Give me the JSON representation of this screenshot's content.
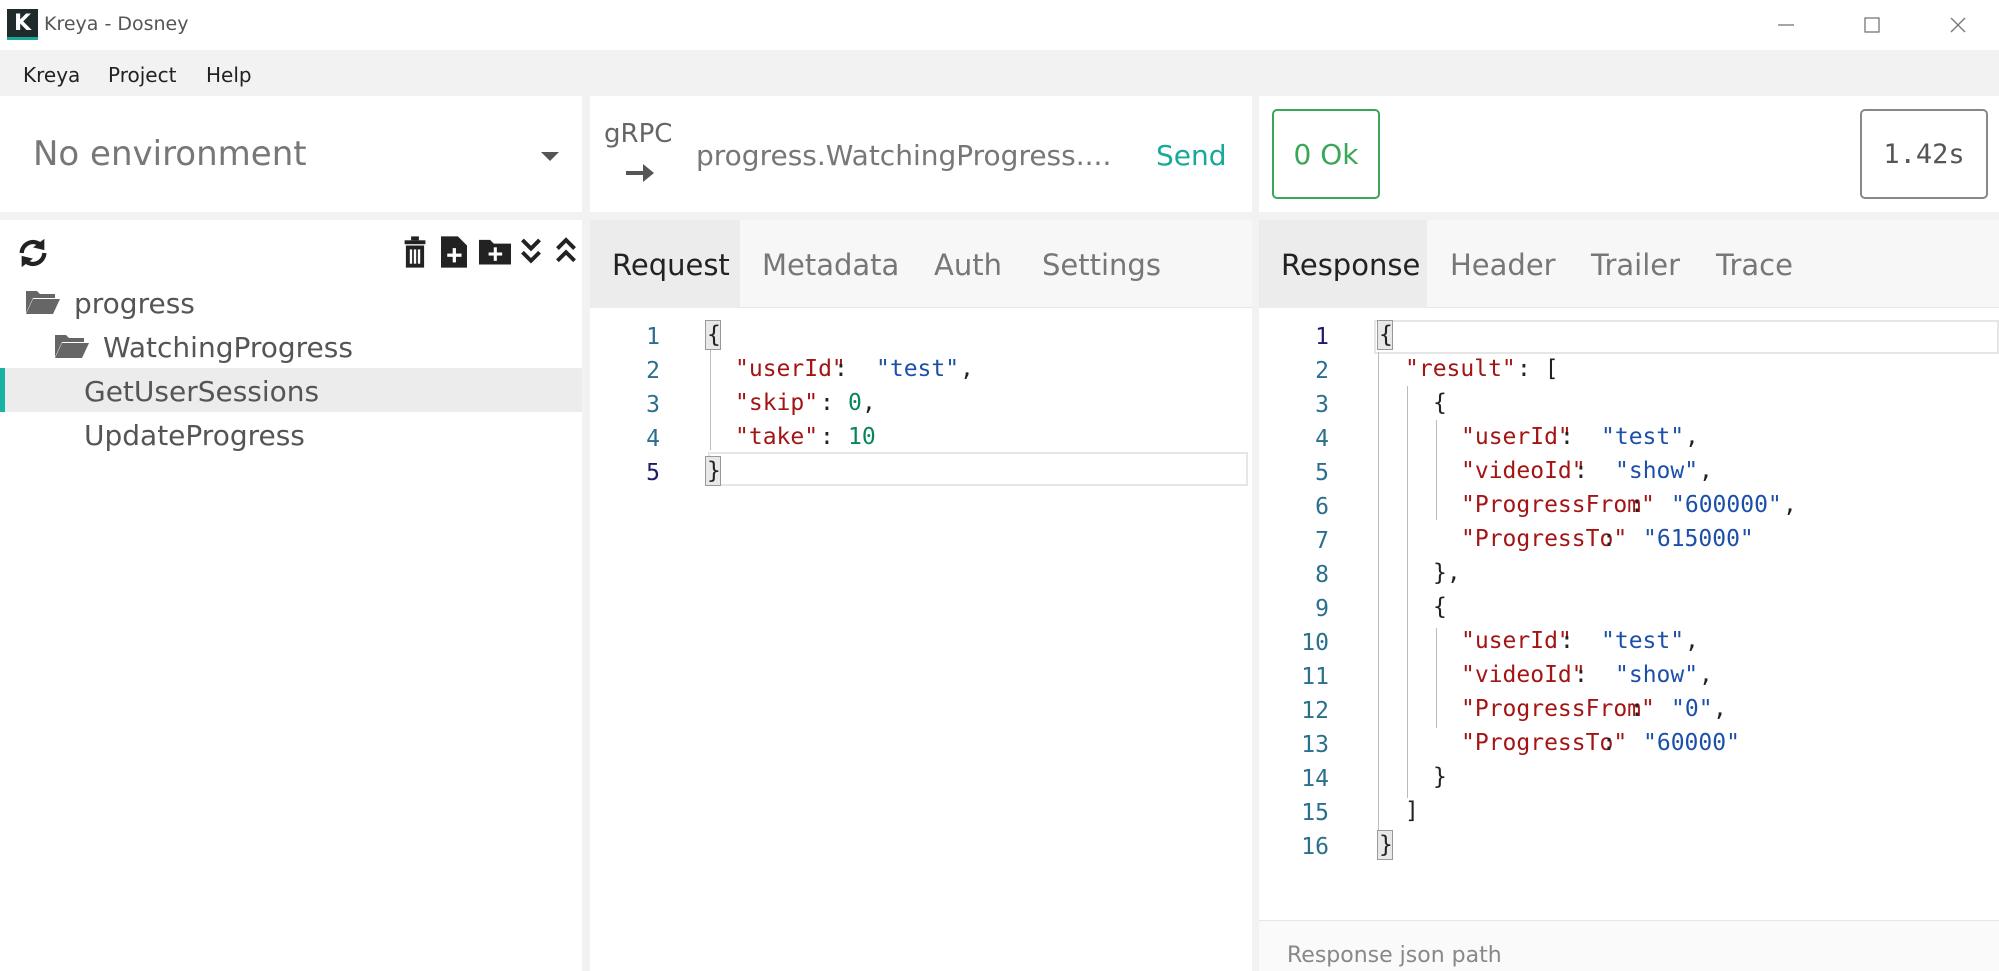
{
  "window": {
    "title": "Kreya - Dosney",
    "logo_letter": "K"
  },
  "menu": [
    "Kreya",
    "Project",
    "Help"
  ],
  "environment": {
    "selected": "No environment"
  },
  "request": {
    "protocol": "gRPC",
    "method": "progress.WatchingProgress....",
    "send_label": "Send",
    "tabs": [
      "Request",
      "Metadata",
      "Auth",
      "Settings"
    ],
    "line_numbers": [
      "1",
      "2",
      "3",
      "4",
      "5"
    ],
    "tokens": [
      "{",
      "\"userId\"",
      ": ",
      "\"test\"",
      ",",
      "\"skip\"",
      ": ",
      "0",
      ",",
      "\"take\"",
      ": ",
      "10",
      "}"
    ]
  },
  "response": {
    "status": "0 Ok",
    "duration": "1.42s",
    "tabs": [
      "Response",
      "Header",
      "Trailer",
      "Trace"
    ],
    "line_numbers": [
      "1",
      "2",
      "3",
      "4",
      "5",
      "6",
      "7",
      "8",
      "9",
      "10",
      "11",
      "12",
      "13",
      "14",
      "15",
      "16"
    ],
    "tokens": [
      "{",
      "\"result\"",
      ": [",
      "{",
      "\"userId\"",
      ": ",
      "\"test\"",
      ",",
      "\"videoId\"",
      ": ",
      "\"show\"",
      ",",
      "\"ProgressFrom\"",
      ": ",
      "\"600000\"",
      ",",
      "\"ProgressTo\"",
      ": ",
      "\"615000\"",
      "},",
      "{",
      "\"userId\"",
      ": ",
      "\"test\"",
      ",",
      "\"videoId\"",
      ": ",
      "\"show\"",
      ",",
      "\"ProgressFrom\"",
      ": ",
      "\"0\"",
      ",",
      "\"ProgressTo\"",
      ": ",
      "\"60000\"",
      "}",
      "]",
      "}"
    ],
    "json_path_placeholder": "Response json path"
  },
  "tree": [
    {
      "label": "progress"
    },
    {
      "label": "WatchingProgress"
    },
    {
      "label": "GetUserSessions"
    },
    {
      "label": "UpdateProgress"
    }
  ],
  "colors": {
    "accent": "#19a99b",
    "ok": "#3aa657",
    "json_key": "#a31515",
    "json_string": "#1c50a8",
    "json_number": "#098658"
  }
}
